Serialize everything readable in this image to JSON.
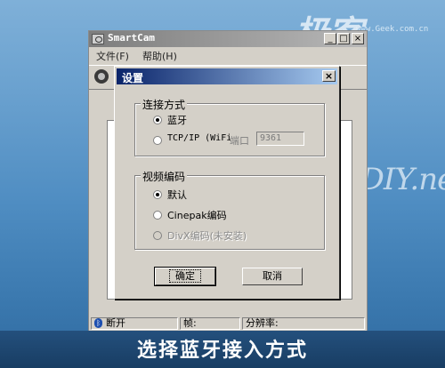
{
  "watermark": {
    "logo": "极客",
    "site": "www.Geek.com.cn",
    "brand": "haoDIY.net"
  },
  "app": {
    "title": "SmartCam",
    "menu": [
      "文件(F)",
      "帮助(H)"
    ],
    "window_buttons": {
      "min": "_",
      "max": "□",
      "close": "×"
    },
    "status": {
      "bt_state": "断开",
      "frame_label": "帧:",
      "resolution_label": "分辨率:"
    }
  },
  "dialog": {
    "title": "设置",
    "close": "×",
    "connection": {
      "legend": "连接方式",
      "options": [
        {
          "label": "蓝牙",
          "selected": true,
          "disabled": false
        },
        {
          "label": "TCP/IP (WiFi",
          "selected": false,
          "disabled": false
        }
      ],
      "port_label": "端口",
      "port_value": "9361"
    },
    "codec": {
      "legend": "视频编码",
      "options": [
        {
          "label": "默认",
          "selected": true,
          "disabled": false
        },
        {
          "label": "Cinepak编码",
          "selected": false,
          "disabled": false
        },
        {
          "label": "DivX编码(未安装)",
          "selected": false,
          "disabled": true
        }
      ]
    },
    "ok_label": "确定",
    "cancel_label": "取消"
  },
  "caption": "选择蓝牙接入方式",
  "colors": {
    "dialog_title_start": "#0a246a",
    "dialog_title_end": "#a6caf0",
    "face": "#d4d0c8"
  }
}
